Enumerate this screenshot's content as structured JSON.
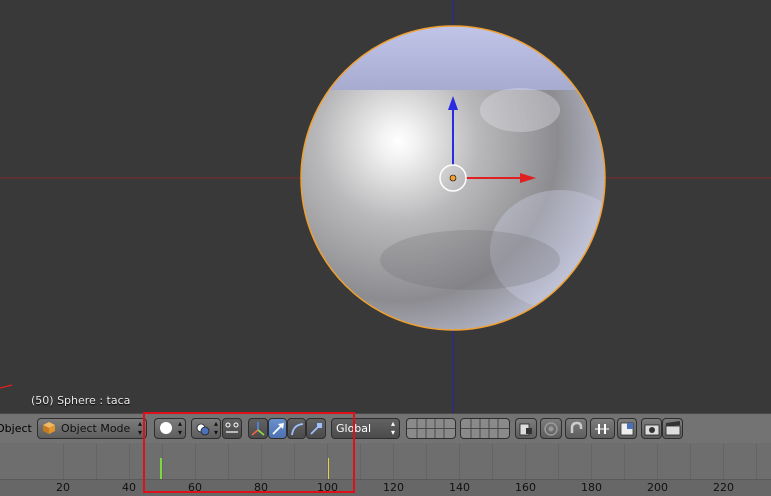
{
  "viewport": {
    "object_info": "(50) Sphere : taca",
    "colors": {
      "background": "#393939",
      "x_axis": "#c2262a",
      "z_axis": "#2a2ae0",
      "outline": "#f0a030"
    }
  },
  "header": {
    "editor_label": "Object",
    "mode_label": "Object Mode",
    "orientation_label": "Global",
    "icons": [
      "viewport-shading-icon",
      "pivot-point-icon",
      "manipulator-toggle-icon",
      "translate-manipulator-icon",
      "rotate-manipulator-icon",
      "scale-manipulator-icon",
      "layers-icon",
      "lock-layers-icon",
      "proportional-edit-icon",
      "snap-icon",
      "snap-element-icon",
      "snap-target-icon",
      "render-icon",
      "render-animation-icon"
    ]
  },
  "timeline": {
    "ticks": [
      "20",
      "40",
      "60",
      "80",
      "100",
      "120",
      "140",
      "160",
      "180",
      "200",
      "220"
    ],
    "current_frame": 50,
    "marker_frame": 100
  }
}
